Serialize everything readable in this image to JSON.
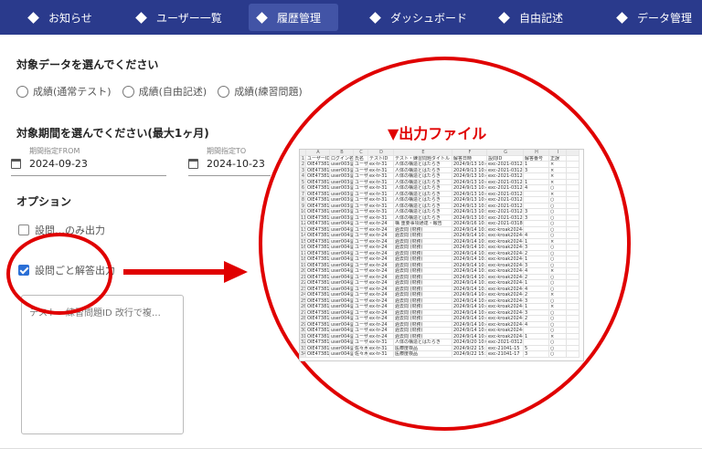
{
  "nav": {
    "items": [
      {
        "label": "お知らせ"
      },
      {
        "label": "ユーザー一覧"
      },
      {
        "label": "履歴管理"
      },
      {
        "label": "ダッシュボード"
      },
      {
        "label": "自由記述"
      },
      {
        "label": "データ管理"
      }
    ],
    "active_index": 2
  },
  "data_target": {
    "title": "対象データを選んでください",
    "options": [
      "成績(通常テスト)",
      "成績(自由記述)",
      "成績(練習問題)"
    ]
  },
  "period": {
    "title": "対象期間を選んでください(最大1ヶ月)",
    "from_label": "期間指定FROM",
    "from_value": "2024-09-23",
    "to_label": "期間指定TO",
    "to_value": "2024-10-23"
  },
  "options": {
    "title": "オプション",
    "option1": "設問…のみ出力",
    "option2": "設問ごと解答出力",
    "option2_checked": true,
    "textarea_placeholder": "テスト・練習問題ID 改行で複…"
  },
  "callout": {
    "label": "▼出力ファイル"
  },
  "sheet": {
    "columns": [
      "A",
      "B",
      "C",
      "D",
      "E",
      "F",
      "G",
      "H",
      "I"
    ],
    "header": [
      "ユーザーID",
      "ログイン名",
      "氏名",
      "テストID",
      "テスト・練習問題タイトル",
      "解答日時",
      "設問ID",
      "解答番号",
      "正誤"
    ],
    "rows": [
      [
        "OIE47381",
        "user003@",
        "ユーザ",
        "ex-tr-31",
        "人体の構造とはたらき",
        "2024/9/13 10:47",
        "exc-2021-0312-1",
        "1",
        "×"
      ],
      [
        "OIE47381",
        "user003@",
        "ユーザ",
        "ex-tr-31",
        "人体の構造とはたらき",
        "2024/9/13 10:48",
        "exc-2021-0312-2",
        "3",
        "×"
      ],
      [
        "OIE47381",
        "user003@",
        "ユーザ",
        "ex-tr-31",
        "人体の構造とはたらき",
        "2024/9/13 10:48",
        "exc-2021-0312-1,2",
        "",
        "×"
      ],
      [
        "OIE47381",
        "user003@",
        "ユーザ",
        "ex-tr-31",
        "人体の構造とはたらき",
        "2024/9/13 10:49",
        "exc-2021-0312-3",
        "1",
        "×"
      ],
      [
        "OIE47381",
        "user003@",
        "ユーザ",
        "ex-tr-31",
        "人体の構造とはたらき",
        "2024/9/13 10:49",
        "exc-2021-0312-2",
        "4",
        "○"
      ],
      [
        "OIE47381",
        "user003@",
        "ユーザ",
        "ex-tr-31",
        "人体の構造とはたらき",
        "2024/9/13 10:49",
        "exc-2021-0312-2,4",
        "",
        "×"
      ],
      [
        "OIE47381",
        "user003@",
        "ユーザ",
        "ex-tr-31",
        "人体の構造とはたらき",
        "2024/9/13 10:49",
        "exc-2021-0312-2,3,4",
        "",
        "○"
      ],
      [
        "OIE47381",
        "user003@",
        "ユーザ",
        "ex-tr-31",
        "人体の構造とはたらき",
        "2024/9/13 10:50",
        "exc-2021-0312-1,2",
        "",
        "○"
      ],
      [
        "OIE47381",
        "user003@",
        "ユーザ",
        "ex-tr-31",
        "人体の構造とはたらき",
        "2024/9/13 10:50",
        "exc-2021-0312-2",
        "3",
        "○"
      ],
      [
        "OIE47381",
        "user003@",
        "ユーザ",
        "ex-tr-31",
        "人体の構造とはたらき",
        "2024/9/13 10:51",
        "exc-2021-0312-2",
        "3",
        "○"
      ],
      [
        "OIE47381",
        "user004@",
        "ユーザ",
        "ex-tr-24",
        "構 重要事項通達・報告",
        "2024/9/16 10:10",
        "exc-2021-0318-2,1,2",
        "",
        "○"
      ],
      [
        "OIE47381",
        "user004@",
        "ユーザ",
        "ex-tr-24",
        "過去問 (財務)",
        "2024/9/14 10:28",
        "exc-kroak2024-2028-2-10",
        "",
        "○"
      ],
      [
        "OIE47381",
        "user004@",
        "ユーザ",
        "ex-tr-24",
        "過去問 (財務)",
        "2024/9/14 10:31",
        "exc-kroak2024-2",
        "4",
        "○"
      ],
      [
        "OIE47381",
        "user004@",
        "ユーザ",
        "ex-tr-24",
        "過去問 (財務)",
        "2024/9/14 10:31",
        "exc-kroak2024-2",
        "1",
        "×"
      ],
      [
        "OIE47381",
        "user004@",
        "ユーザ",
        "ex-tr-24",
        "過去問 (財務)",
        "2024/9/14 10:32",
        "exc-kroak2024-2",
        "3",
        "○"
      ],
      [
        "OIE47381",
        "user004@",
        "ユーザ",
        "ex-tr-24",
        "過去問 (財務)",
        "2024/9/14 10:33",
        "exc-kroak2024-2",
        "2",
        "○"
      ],
      [
        "OIE47381",
        "user004@",
        "ユーザ",
        "ex-tr-24",
        "過去問 (財務)",
        "2024/9/14 10:34",
        "exc-kroak2024-2",
        "1",
        "○"
      ],
      [
        "OIE47381",
        "user004@",
        "ユーザ",
        "ex-tr-24",
        "過去問 (財務)",
        "2024/9/14 10:35",
        "exc-kroak2024-2",
        "3",
        "○"
      ],
      [
        "OIE47381",
        "user004@",
        "ユーザ",
        "ex-tr-24",
        "過去問 (財務)",
        "2024/9/14 10:36",
        "exc-kroak2024-2",
        "4",
        "×"
      ],
      [
        "OIE47381",
        "user004@",
        "ユーザ",
        "ex-tr-24",
        "過去問 (財務)",
        "2024/9/14 10:37",
        "exc-kroak2024-2",
        "2",
        "○"
      ],
      [
        "OIE47381",
        "user004@",
        "ユーザ",
        "ex-tr-24",
        "過去問 (財務)",
        "2024/9/14 10:38",
        "exc-kroak2024-2",
        "1",
        "○"
      ],
      [
        "OIE47381",
        "user004@",
        "ユーザ",
        "ex-tr-24",
        "過去問 (財務)",
        "2024/9/14 10:39",
        "exc-kroak2024-2",
        "4",
        "○"
      ],
      [
        "OIE47381",
        "user004@",
        "ユーザ",
        "ex-tr-24",
        "過去問 (財務)",
        "2024/9/14 10:40",
        "exc-kroak2024-2",
        "2",
        "×"
      ],
      [
        "OIE47381",
        "user004@",
        "ユーザ",
        "ex-tr-24",
        "過去問 (財務)",
        "2024/9/14 10:41",
        "exc-kroak2024-2",
        "3",
        "○"
      ],
      [
        "OIE47381",
        "user004@",
        "ユーザ",
        "ex-tr-24",
        "過去問 (財務)",
        "2024/9/14 10:42",
        "exc-kroak2024-2",
        "1",
        "×"
      ],
      [
        "OIE47381",
        "user004@",
        "ユーザ",
        "ex-tr-24",
        "過去問 (財務)",
        "2024/9/14 10:43",
        "exc-kroak2024-2",
        "3",
        "○"
      ],
      [
        "OIE47381",
        "user004@",
        "ユーザ",
        "ex-tr-24",
        "過去問 (財務)",
        "2024/9/14 10:44",
        "exc-kroak2024-2",
        "2",
        "○"
      ],
      [
        "OIE47381",
        "user004@",
        "ユーザ",
        "ex-tr-24",
        "過去問 (財務)",
        "2024/9/14 10:45",
        "exc-kroak2024-2",
        "4",
        "○"
      ],
      [
        "OIE47381",
        "user004@",
        "ユーザ",
        "ex-tr-24",
        "過去問 (財務)",
        "2024/9/14 10:46",
        "exc-kroak2024-2028-1-31",
        "",
        "○"
      ],
      [
        "OIE47381",
        "user004@",
        "ユーザ",
        "ex-tr-24",
        "過去問 (財務)",
        "2024/9/14 10:47",
        "exc-kroak2024-2",
        "1",
        "×"
      ],
      [
        "OIE47381",
        "user004@",
        "ユーザ",
        "ex-tr-31",
        "人体の構造とはたらき",
        "2024/9/20 10:03",
        "exc-2021-0312-1,4",
        "",
        "○"
      ],
      [
        "OIE47381",
        "user004@",
        "佐々木 莉",
        "ex-tr-31",
        "医療度検品",
        "2024/9/22 15:10",
        "exc-21041-15",
        "5",
        "○"
      ],
      [
        "OIE47381",
        "user004@",
        "佐々木 莉",
        "ex-tr-31",
        "医療度検品",
        "2024/9/22 15:10",
        "exc-21041-17",
        "3",
        "○"
      ]
    ]
  },
  "colors": {
    "nav_bg": "#2a3a8c",
    "nav_active": "#4254a6",
    "highlight_red": "#e00000",
    "checkbox_blue": "#2a6fd6"
  }
}
